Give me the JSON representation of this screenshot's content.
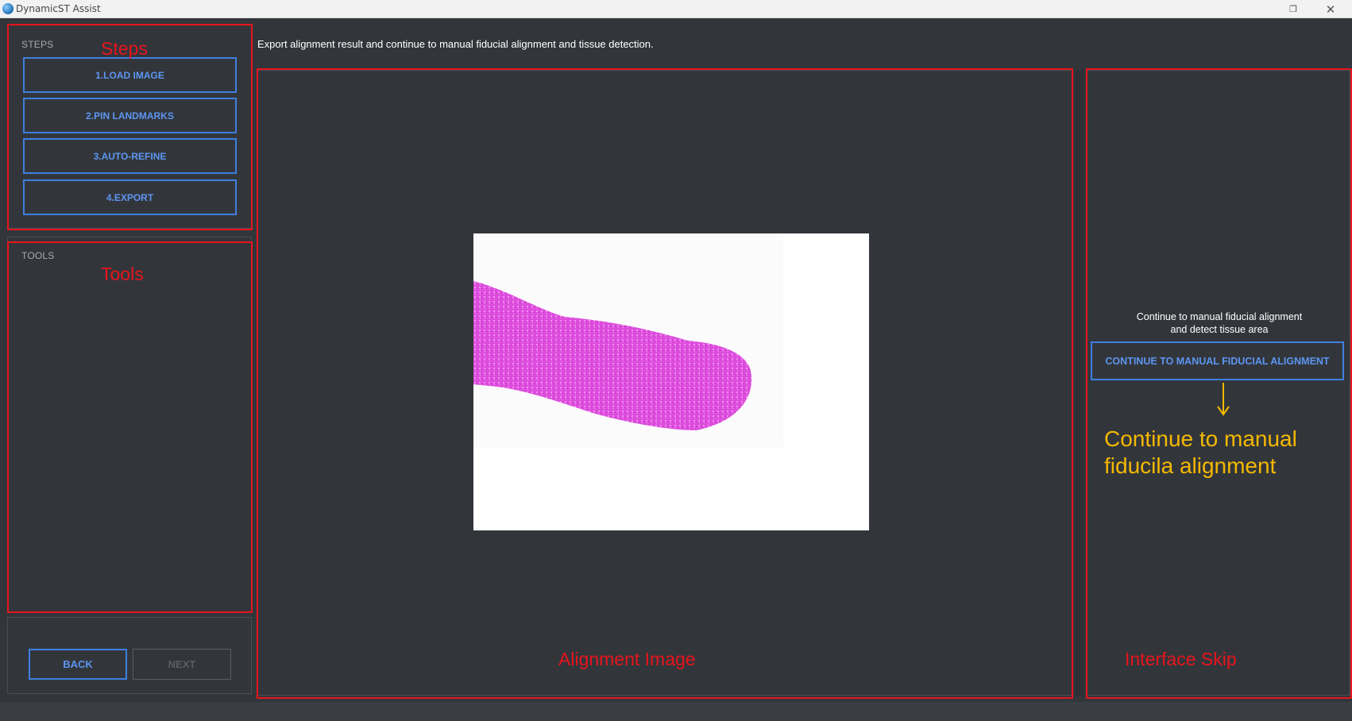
{
  "window": {
    "title": "DynamicST Assist",
    "restore_icon": "restore-icon",
    "close_icon": "close-icon"
  },
  "steps": {
    "label": "STEPS",
    "items": [
      {
        "label": "1.LOAD IMAGE"
      },
      {
        "label": "2.PIN LANDMARKS"
      },
      {
        "label": "3.AUTO-REFINE"
      },
      {
        "label": "4.EXPORT"
      }
    ]
  },
  "tools": {
    "label": "TOOLS"
  },
  "navigation": {
    "back_label": "BACK",
    "next_label": "NEXT"
  },
  "main": {
    "instruction": "Export alignment result and continue to manual fiducial alignment and tissue detection."
  },
  "skip": {
    "description_line1": "Continue to manual fiducial alignment",
    "description_line2": "and detect tissue area",
    "button_label": "CONTINUE TO MANUAL FIDUCIAL ALIGNMENT"
  },
  "annotations": {
    "steps": "Steps",
    "tools": "Tools",
    "alignment_image": "Alignment Image",
    "interface_skip": "Interface Skip",
    "continue_note": "Continue to manual\nfiducila alignment"
  },
  "colors": {
    "background": "#32363b",
    "accent": "#3f7fe0",
    "annotation_red": "#e8141c",
    "annotation_yellow": "#f5b800",
    "tissue": "#d946d8"
  }
}
